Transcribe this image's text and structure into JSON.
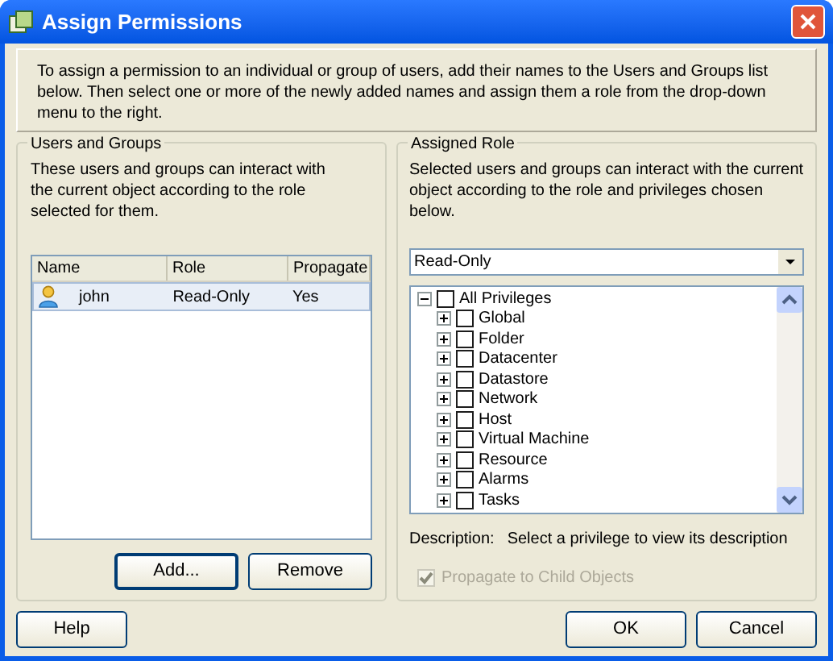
{
  "window": {
    "title": "Assign Permissions"
  },
  "intro": "To assign a permission to an individual or group of users, add their names to the Users and Groups list below. Then select one or more of the newly added names and assign them a role from the drop-down menu to the right.",
  "users_groups": {
    "title": "Users and Groups",
    "description": "These users and groups can interact with the current object according to the role selected for them.",
    "columns": [
      "Name",
      "Role",
      "Propagate"
    ],
    "rows": [
      {
        "name": "john",
        "role": "Read-Only",
        "propagate": "Yes",
        "selected": true
      }
    ],
    "buttons": [
      {
        "label": "Add...",
        "default": true
      },
      {
        "label": "Remove",
        "default": false
      }
    ]
  },
  "assigned_role": {
    "title": "Assigned Role",
    "description": "Selected users and groups can interact with the current object according to the role and privileges chosen below.",
    "role": "Read-Only",
    "tree": {
      "label": "All Privileges",
      "expanded": true,
      "checked": false,
      "children": [
        {
          "label": "Global",
          "expanded": false,
          "checked": false
        },
        {
          "label": "Folder",
          "expanded": false,
          "checked": false
        },
        {
          "label": "Datacenter",
          "expanded": false,
          "checked": false
        },
        {
          "label": "Datastore",
          "expanded": false,
          "checked": false
        },
        {
          "label": "Network",
          "expanded": false,
          "checked": false
        },
        {
          "label": "Host",
          "expanded": false,
          "checked": false
        },
        {
          "label": "Virtual Machine",
          "expanded": false,
          "checked": false
        },
        {
          "label": "Resource",
          "expanded": false,
          "checked": false
        },
        {
          "label": "Alarms",
          "expanded": false,
          "checked": false
        },
        {
          "label": "Tasks",
          "expanded": false,
          "checked": false
        }
      ]
    },
    "description_label": "Description:",
    "description_text": "Select a privilege to view its description",
    "propagate": {
      "label": "Propagate to Child Objects",
      "checked": true,
      "disabled": true
    }
  },
  "footer": {
    "left": [
      {
        "label": "Help"
      }
    ],
    "right": [
      {
        "label": "OK"
      },
      {
        "label": "Cancel"
      }
    ]
  }
}
